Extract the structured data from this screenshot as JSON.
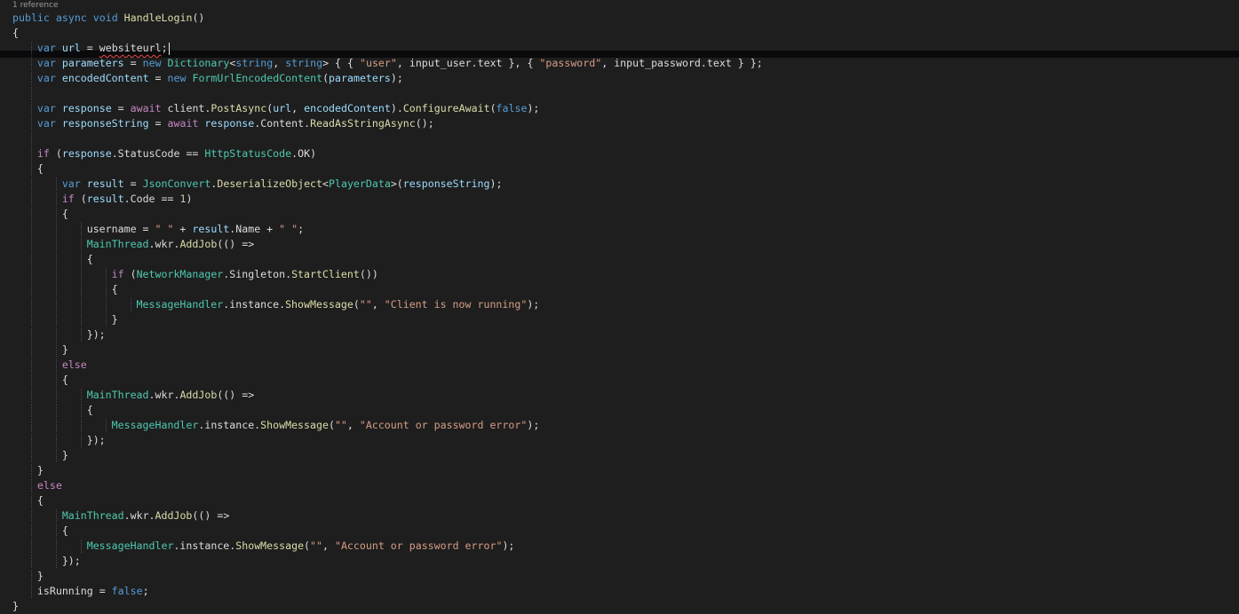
{
  "editor": {
    "codelens_label": "1 reference",
    "colors": {
      "background": "#1e1e1e",
      "keyword": "#569cd6",
      "control_keyword": "#c586c0",
      "type": "#4ec9b0",
      "method": "#dcdcaa",
      "variable": "#9cdcfe",
      "string": "#d69d85",
      "number": "#b5cea8",
      "plain_text": "#dcdcdc",
      "codelens": "#9b9b9b",
      "error_squiggle": "#f14c4c",
      "current_line_band": "#0a0a0c",
      "indent_guide": "#4a4a50"
    },
    "lines": [
      {
        "i": 0,
        "t": [
          [
            "k",
            "public"
          ],
          [
            "p",
            " "
          ],
          [
            "k",
            "async"
          ],
          [
            "p",
            " "
          ],
          [
            "k",
            "void"
          ],
          [
            "p",
            " "
          ],
          [
            "m",
            "HandleLogin"
          ],
          [
            "p",
            "()"
          ]
        ]
      },
      {
        "i": 0,
        "t": [
          [
            "p",
            "{"
          ]
        ]
      },
      {
        "i": 1,
        "t": [
          [
            "k",
            "var"
          ],
          [
            "p",
            " "
          ],
          [
            "v",
            "url"
          ],
          [
            "p",
            " = "
          ],
          [
            "e",
            "websiteurl"
          ],
          [
            "p",
            ";"
          ],
          [
            "caret",
            ""
          ]
        ]
      },
      {
        "i": 1,
        "t": [
          [
            "k",
            "var"
          ],
          [
            "p",
            " "
          ],
          [
            "v",
            "parameters"
          ],
          [
            "p",
            " = "
          ],
          [
            "k",
            "new"
          ],
          [
            "p",
            " "
          ],
          [
            "t",
            "Dictionary"
          ],
          [
            "p",
            "<"
          ],
          [
            "k",
            "string"
          ],
          [
            "p",
            ", "
          ],
          [
            "k",
            "string"
          ],
          [
            "p",
            "> { { "
          ],
          [
            "s",
            "\"user\""
          ],
          [
            "p",
            ", input_user.text }, { "
          ],
          [
            "s",
            "\"password\""
          ],
          [
            "p",
            ", input_password.text } };"
          ]
        ]
      },
      {
        "i": 1,
        "t": [
          [
            "k",
            "var"
          ],
          [
            "p",
            " "
          ],
          [
            "v",
            "encodedContent"
          ],
          [
            "p",
            " = "
          ],
          [
            "k",
            "new"
          ],
          [
            "p",
            " "
          ],
          [
            "t",
            "FormUrlEncodedContent"
          ],
          [
            "p",
            "("
          ],
          [
            "v",
            "parameters"
          ],
          [
            "p",
            ");"
          ]
        ]
      },
      {
        "i": 1,
        "t": []
      },
      {
        "i": 1,
        "t": [
          [
            "k",
            "var"
          ],
          [
            "p",
            " "
          ],
          [
            "v",
            "response"
          ],
          [
            "p",
            " = "
          ],
          [
            "c",
            "await"
          ],
          [
            "p",
            " client."
          ],
          [
            "m",
            "PostAsync"
          ],
          [
            "p",
            "("
          ],
          [
            "v",
            "url"
          ],
          [
            "p",
            ", "
          ],
          [
            "v",
            "encodedContent"
          ],
          [
            "p",
            ")."
          ],
          [
            "m",
            "ConfigureAwait"
          ],
          [
            "p",
            "("
          ],
          [
            "k",
            "false"
          ],
          [
            "p",
            ");"
          ]
        ]
      },
      {
        "i": 1,
        "t": [
          [
            "k",
            "var"
          ],
          [
            "p",
            " "
          ],
          [
            "v",
            "responseString"
          ],
          [
            "p",
            " = "
          ],
          [
            "c",
            "await"
          ],
          [
            "p",
            " "
          ],
          [
            "v",
            "response"
          ],
          [
            "p",
            ".Content."
          ],
          [
            "m",
            "ReadAsStringAsync"
          ],
          [
            "p",
            "();"
          ]
        ]
      },
      {
        "i": 1,
        "t": []
      },
      {
        "i": 1,
        "t": [
          [
            "c",
            "if"
          ],
          [
            "p",
            " ("
          ],
          [
            "v",
            "response"
          ],
          [
            "p",
            ".StatusCode == "
          ],
          [
            "t",
            "HttpStatusCode"
          ],
          [
            "p",
            ".OK)"
          ]
        ]
      },
      {
        "i": 1,
        "t": [
          [
            "p",
            "{"
          ]
        ]
      },
      {
        "i": 2,
        "t": [
          [
            "k",
            "var"
          ],
          [
            "p",
            " "
          ],
          [
            "v",
            "result"
          ],
          [
            "p",
            " = "
          ],
          [
            "t",
            "JsonConvert"
          ],
          [
            "p",
            "."
          ],
          [
            "m",
            "DeserializeObject"
          ],
          [
            "p",
            "<"
          ],
          [
            "t",
            "PlayerData"
          ],
          [
            "p",
            ">("
          ],
          [
            "v",
            "responseString"
          ],
          [
            "p",
            ");"
          ]
        ]
      },
      {
        "i": 2,
        "t": [
          [
            "c",
            "if"
          ],
          [
            "p",
            " ("
          ],
          [
            "v",
            "result"
          ],
          [
            "p",
            ".Code == "
          ],
          [
            "n",
            "1"
          ],
          [
            "p",
            ")"
          ]
        ]
      },
      {
        "i": 2,
        "t": [
          [
            "p",
            "{"
          ]
        ]
      },
      {
        "i": 3,
        "t": [
          [
            "p",
            "username = "
          ],
          [
            "s",
            "\" \""
          ],
          [
            "p",
            " + "
          ],
          [
            "v",
            "result"
          ],
          [
            "p",
            ".Name + "
          ],
          [
            "s",
            "\" \""
          ],
          [
            "p",
            ";"
          ]
        ]
      },
      {
        "i": 3,
        "t": [
          [
            "t",
            "MainThread"
          ],
          [
            "p",
            ".wkr."
          ],
          [
            "m",
            "AddJob"
          ],
          [
            "p",
            "(() =>"
          ]
        ]
      },
      {
        "i": 3,
        "t": [
          [
            "p",
            "{"
          ]
        ]
      },
      {
        "i": 4,
        "t": [
          [
            "c",
            "if"
          ],
          [
            "p",
            " ("
          ],
          [
            "t",
            "NetworkManager"
          ],
          [
            "p",
            ".Singleton."
          ],
          [
            "m",
            "StartClient"
          ],
          [
            "p",
            "())"
          ]
        ]
      },
      {
        "i": 4,
        "t": [
          [
            "p",
            "{"
          ]
        ]
      },
      {
        "i": 5,
        "t": [
          [
            "t",
            "MessageHandler"
          ],
          [
            "p",
            ".instance."
          ],
          [
            "m",
            "ShowMessage"
          ],
          [
            "p",
            "("
          ],
          [
            "s",
            "\"\""
          ],
          [
            "p",
            ", "
          ],
          [
            "s",
            "\"Client is now running\""
          ],
          [
            "p",
            ");"
          ]
        ]
      },
      {
        "i": 4,
        "t": [
          [
            "p",
            "}"
          ]
        ]
      },
      {
        "i": 3,
        "t": [
          [
            "p",
            "});"
          ]
        ]
      },
      {
        "i": 2,
        "t": [
          [
            "p",
            "}"
          ]
        ]
      },
      {
        "i": 2,
        "t": [
          [
            "c",
            "else"
          ]
        ]
      },
      {
        "i": 2,
        "t": [
          [
            "p",
            "{"
          ]
        ]
      },
      {
        "i": 3,
        "t": [
          [
            "t",
            "MainThread"
          ],
          [
            "p",
            ".wkr."
          ],
          [
            "m",
            "AddJob"
          ],
          [
            "p",
            "(() =>"
          ]
        ]
      },
      {
        "i": 3,
        "t": [
          [
            "p",
            "{"
          ]
        ]
      },
      {
        "i": 4,
        "t": [
          [
            "t",
            "MessageHandler"
          ],
          [
            "p",
            ".instance."
          ],
          [
            "m",
            "ShowMessage"
          ],
          [
            "p",
            "("
          ],
          [
            "s",
            "\"\""
          ],
          [
            "p",
            ", "
          ],
          [
            "s",
            "\"Account or password error\""
          ],
          [
            "p",
            ");"
          ]
        ]
      },
      {
        "i": 3,
        "t": [
          [
            "p",
            "});"
          ]
        ]
      },
      {
        "i": 2,
        "t": [
          [
            "p",
            "}"
          ]
        ]
      },
      {
        "i": 1,
        "t": [
          [
            "p",
            "}"
          ]
        ]
      },
      {
        "i": 1,
        "t": [
          [
            "c",
            "else"
          ]
        ]
      },
      {
        "i": 1,
        "t": [
          [
            "p",
            "{"
          ]
        ]
      },
      {
        "i": 2,
        "t": [
          [
            "t",
            "MainThread"
          ],
          [
            "p",
            ".wkr."
          ],
          [
            "m",
            "AddJob"
          ],
          [
            "p",
            "(() =>"
          ]
        ]
      },
      {
        "i": 2,
        "t": [
          [
            "p",
            "{"
          ]
        ]
      },
      {
        "i": 3,
        "t": [
          [
            "t",
            "MessageHandler"
          ],
          [
            "p",
            ".instance."
          ],
          [
            "m",
            "ShowMessage"
          ],
          [
            "p",
            "("
          ],
          [
            "s",
            "\"\""
          ],
          [
            "p",
            ", "
          ],
          [
            "s",
            "\"Account or password error\""
          ],
          [
            "p",
            ");"
          ]
        ]
      },
      {
        "i": 2,
        "t": [
          [
            "p",
            "});"
          ]
        ]
      },
      {
        "i": 1,
        "t": [
          [
            "p",
            "}"
          ]
        ]
      },
      {
        "i": 1,
        "t": [
          [
            "p",
            "isRunning = "
          ],
          [
            "k",
            "false"
          ],
          [
            "p",
            ";"
          ]
        ]
      },
      {
        "i": 0,
        "t": [
          [
            "p",
            "}"
          ]
        ]
      }
    ]
  }
}
